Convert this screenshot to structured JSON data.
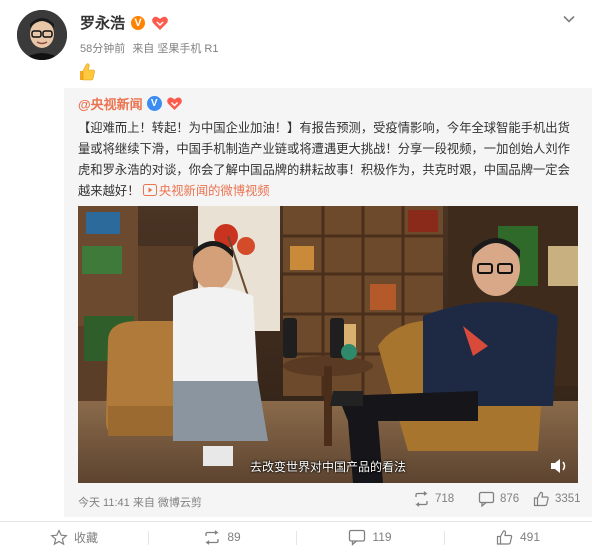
{
  "post": {
    "author_name": "罗永浩",
    "vip_badge": "V",
    "time_ago": "58分钟前",
    "source": "来自 坚果手机 R1",
    "emoji": "thumbs-up-icon"
  },
  "repost": {
    "original_author": "@央视新闻",
    "verified_badge": "V",
    "text": "【迎难而上！转起！为中国企业加油！】有报告预测，受疫情影响，今年全球智能手机出货量或将继续下滑，中国手机制造产业链或将遭遇更大挑战！分享一段视频，一加创始人刘作虎和罗永浩的对谈，你会了解中国品牌的耕耘故事！积极作为，共克时艰，中国品牌一定会越来越好！",
    "video_link_label": "央视新闻的微博视频",
    "video_subtitle": "去改变世界对中国产品的看法",
    "timestamp": "今天 11:41 来自 微博云剪",
    "repost_count": "718",
    "comment_count": "876",
    "like_count": "3351"
  },
  "actions": {
    "favorite": "收藏",
    "repost": "89",
    "comment": "119",
    "like": "491"
  },
  "colors": {
    "accent": "#eb7350",
    "vip_orange": "#ff8200",
    "verified_blue": "#3d8cf2",
    "gray_text": "#808080"
  }
}
